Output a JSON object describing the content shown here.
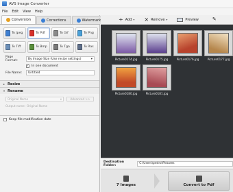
{
  "window": {
    "title": "AVS Image Converter"
  },
  "menu": [
    "File",
    "Edit",
    "View",
    "Help"
  ],
  "tabs": [
    {
      "label": "Conversion",
      "icon": "conversion-icon",
      "color": "#e6a020",
      "active": true
    },
    {
      "label": "Corrections",
      "icon": "corrections-icon",
      "color": "#3a7fd5",
      "active": false
    },
    {
      "label": "Watermark",
      "icon": "watermark-icon",
      "color": "#3a7fd5",
      "active": false
    }
  ],
  "formats": [
    {
      "label": "To Jpeg",
      "color": "#3f7fd1"
    },
    {
      "label": "To Pdf",
      "color": "#d8312b"
    },
    {
      "label": "To Gif",
      "color": "#8a8a8a"
    },
    {
      "label": "To Png",
      "color": "#4aa0d8"
    },
    {
      "label": "To Tiff",
      "color": "#6b8fb8"
    },
    {
      "label": "To Bmp",
      "color": "#5a8f3c"
    },
    {
      "label": "To Tga",
      "color": "#7a7a7a"
    },
    {
      "label": "To Ras",
      "color": "#5f6f8a"
    }
  ],
  "settings": {
    "page_format_label": "Page Format:",
    "page_format_value": "By Image Size (Use resize settings)",
    "in_one_document_label": "In one document",
    "in_one_document_checked": true,
    "file_name_label": "File Name:",
    "file_name_value": "Untitled"
  },
  "sections": {
    "resize": "Resize",
    "rename": "Rename",
    "rename_placeholder": "Original Name",
    "advanced_label": "Advanced >>",
    "output_name_label": "Output name:",
    "output_name_value": "Original Name",
    "keep_date_label": "Keep file modification date"
  },
  "toolbar": {
    "add_label": "Add",
    "remove_label": "Remove",
    "preview_label": "Preview"
  },
  "images": [
    {
      "name": "Picture0174.jpg",
      "colors": [
        "#7c5aa6",
        "#e0e6f0"
      ]
    },
    {
      "name": "Picture0175.jpg",
      "colors": [
        "#5b3f8e",
        "#dfe3ee"
      ]
    },
    {
      "name": "Picture0176.jpg",
      "colors": [
        "#b8432d",
        "#e9a070"
      ]
    },
    {
      "name": "Picture0177.jpg",
      "colors": [
        "#b5864c",
        "#f3e2c4"
      ]
    },
    {
      "name": "Picture0180.jpg",
      "colors": [
        "#c24a28",
        "#f0a040"
      ]
    },
    {
      "name": "Picture0181.jpg",
      "colors": [
        "#a84a54",
        "#e0a0a0"
      ]
    }
  ],
  "destination": {
    "label": "Destination Folder:",
    "value": "C:\\Users\\pedro\\Pictures"
  },
  "bottom": {
    "count_label": "7 Images",
    "convert_label": "Convert to Pdf"
  }
}
